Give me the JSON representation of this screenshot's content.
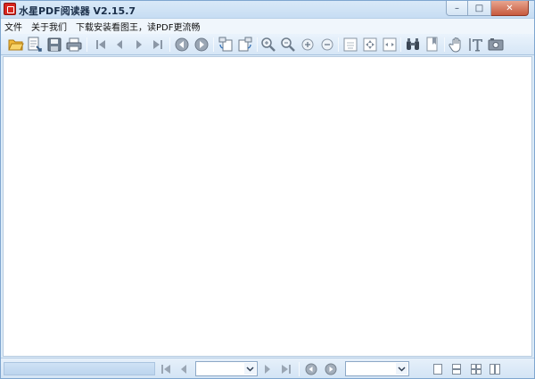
{
  "window": {
    "title": "水星PDF阅读器 V2.15.7",
    "min_glyph": "–",
    "max_glyph": "□",
    "close_glyph": "✕"
  },
  "menu": [
    {
      "label": "文件"
    },
    {
      "label": "关于我们"
    },
    {
      "label": "下载安装看图王，读PDF更流畅"
    }
  ],
  "toolbar": {
    "icons": [
      "open-folder-icon",
      "open-recent-icon",
      "save-icon",
      "print-icon",
      "first-page-icon",
      "prev-page-icon",
      "next-page-icon",
      "last-page-icon",
      "back-icon",
      "forward-icon",
      "rotate-left-icon",
      "rotate-right-icon",
      "zoom-in-icon",
      "zoom-out-icon",
      "zoom-plus-icon",
      "zoom-minus-icon",
      "actual-size-icon",
      "fit-page-icon",
      "fit-width-icon",
      "find-icon",
      "bookmark-icon",
      "hand-tool-icon",
      "text-select-icon",
      "snapshot-icon"
    ]
  },
  "status": {
    "page_value": "",
    "zoom_value": "",
    "accent": "#2f6fb5"
  }
}
